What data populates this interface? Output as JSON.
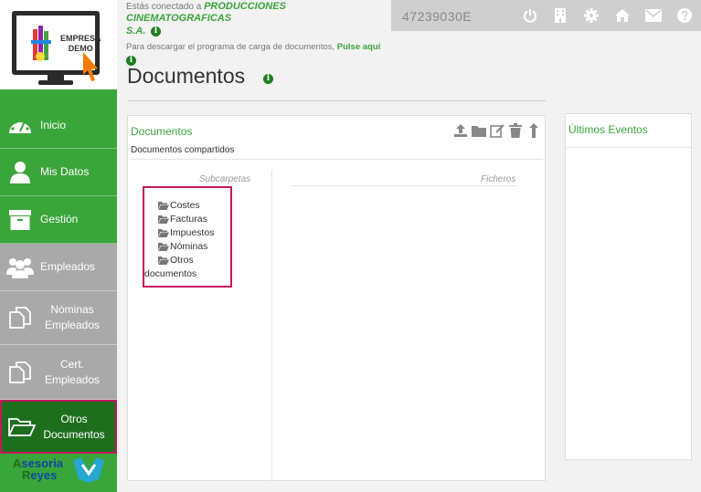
{
  "header": {
    "connected_prefix": "Estás conectado a",
    "company_line1": "PRODUCCIONES CINEMATOGRAFICAS",
    "company_line2": "S.A.",
    "download_text": "Para descargar el programa de carga de documentos,",
    "download_link": "Pulse aquí",
    "nif": "47239030E",
    "info_glyph": "i"
  },
  "logo": {
    "line1": "EMPRESA",
    "line2": "DEMO",
    "bottom_line1": "sesoria",
    "bottom_line2": "eyes"
  },
  "sidebar": {
    "items": [
      {
        "label": "Inicio",
        "icon": "gauge-icon"
      },
      {
        "label": "Mis Datos",
        "icon": "user-icon"
      },
      {
        "label": "Gestión",
        "icon": "archive-box-icon"
      },
      {
        "label": "Empleados",
        "icon": "group-icon"
      },
      {
        "label_line1": "Nóminas",
        "label_line2": "Empleados",
        "icon": "documents-icon"
      },
      {
        "label_line1": "Cert.",
        "label_line2": "Empleados",
        "icon": "documents-icon"
      },
      {
        "label_line1": "Otros",
        "label_line2": "Documentos",
        "icon": "folder-open-icon"
      }
    ]
  },
  "page": {
    "title": "Documentos"
  },
  "documents": {
    "panel_title": "Documentos",
    "shared_label": "Documentos compartidos",
    "subfolders_header": "Subcarpetas",
    "files_header": "Ficheros",
    "folders": [
      "Costes",
      "Facturas",
      "Impuestos",
      "Nóminas"
    ],
    "last_folder_line1": "Otros",
    "last_folder_line2": "documentos"
  },
  "events": {
    "title": "Últimos Eventos"
  },
  "colors": {
    "brand_green": "#3aa53a",
    "dark_green": "#1e6e1e",
    "highlight": "#c2185b",
    "nav_gray": "#a9a9a9"
  }
}
